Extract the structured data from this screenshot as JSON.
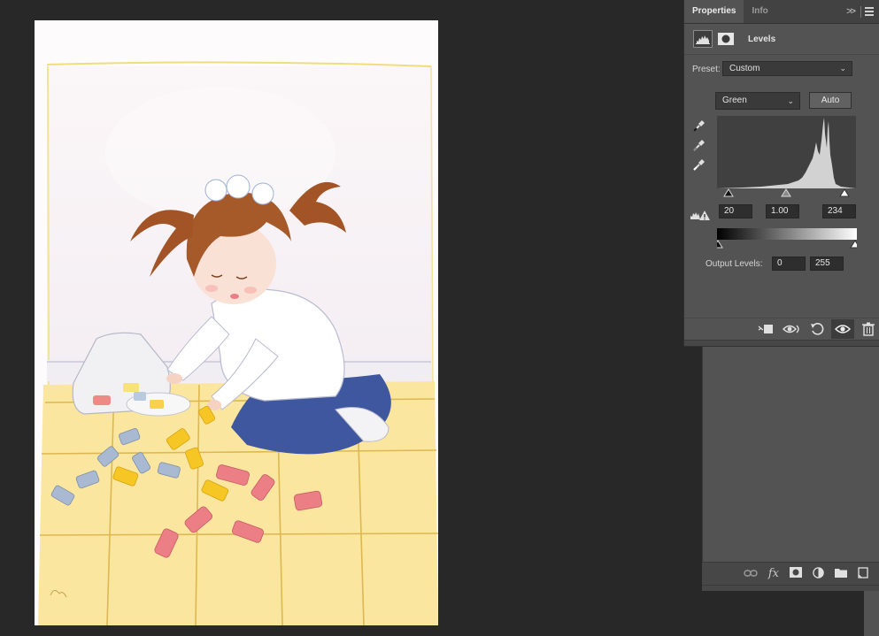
{
  "properties_panel": {
    "tabs": [
      {
        "label": "Properties",
        "active": true
      },
      {
        "label": "Info",
        "active": false
      }
    ],
    "collapse_icon": "double-chevron-right-icon",
    "menu_icon": "panel-menu-icon",
    "adjustment": {
      "title": "Levels",
      "icons": [
        "levels-histogram-icon",
        "layer-mask-icon"
      ]
    },
    "preset": {
      "label": "Preset:",
      "value": "Custom"
    },
    "channel": {
      "value": "Green"
    },
    "auto_label": "Auto",
    "eyedroppers": [
      "black-point-eyedropper-icon",
      "gray-point-eyedropper-icon",
      "white-point-eyedropper-icon"
    ],
    "input_levels": {
      "black": "20",
      "gamma": "1.00",
      "white": "234"
    },
    "output": {
      "label": "Output Levels:",
      "black": "0",
      "white": "255"
    },
    "footer_icons": [
      "clip-to-layer-icon",
      "view-previous-state-icon",
      "reset-icon",
      "visibility-eye-icon",
      "trash-icon"
    ]
  },
  "layers_toolbar": {
    "icons": [
      "link-layers-icon",
      "fx-icon",
      "add-mask-icon",
      "adjustment-layer-icon",
      "new-group-folder-icon",
      "new-layer-icon"
    ]
  },
  "colors": {
    "app_background": "#282828",
    "panel_background": "#535353",
    "tab_bar": "#424242",
    "input_field": "#2e2e2e"
  }
}
